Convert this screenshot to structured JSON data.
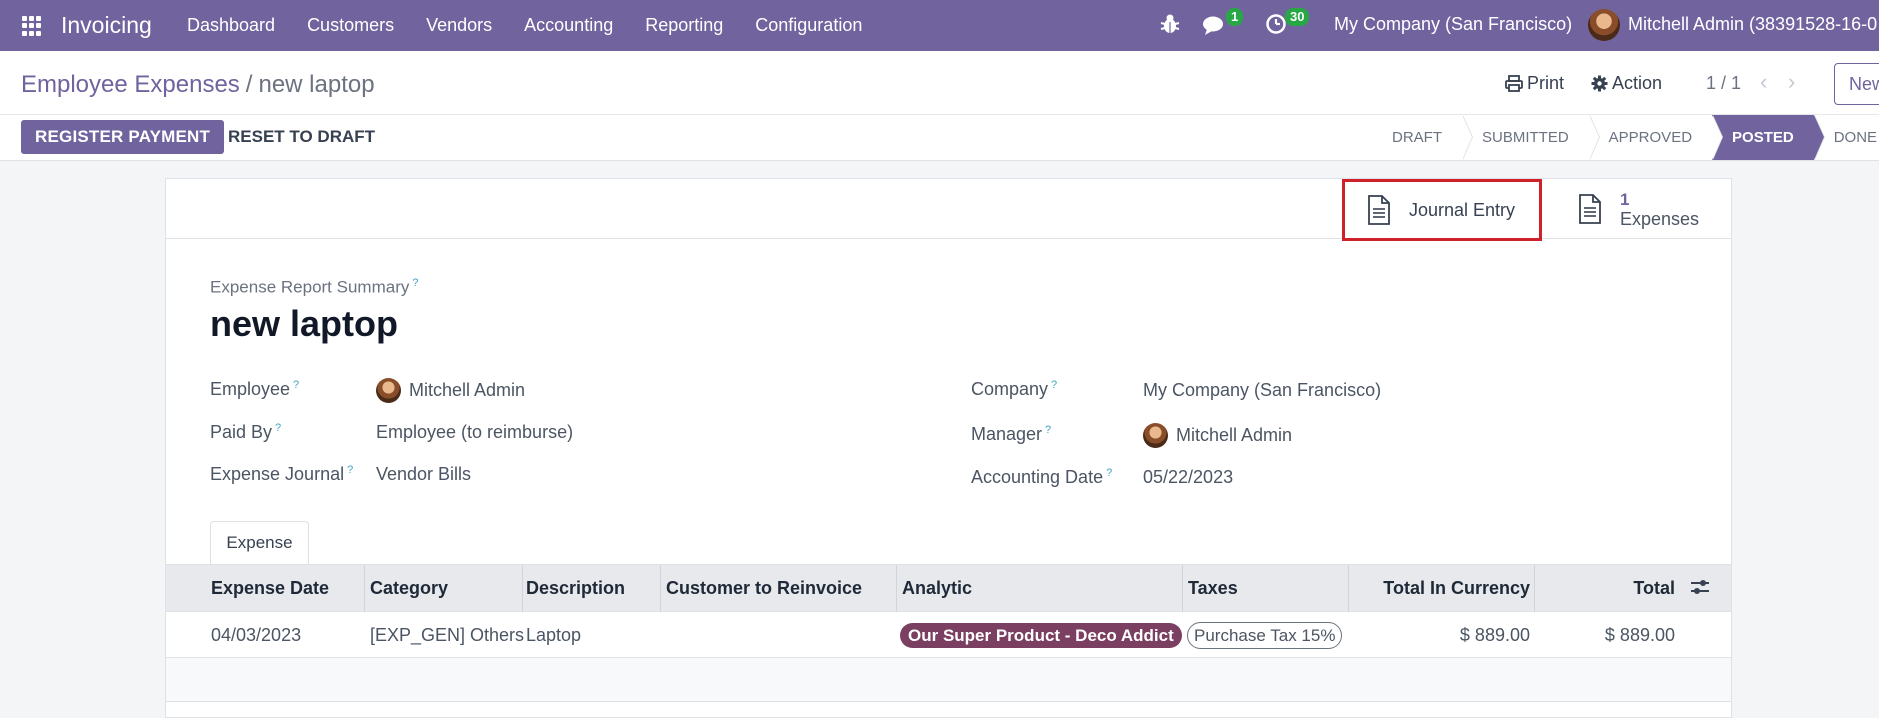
{
  "navbar": {
    "app_name": "Invoicing",
    "menu": [
      "Dashboard",
      "Customers",
      "Vendors",
      "Accounting",
      "Reporting",
      "Configuration"
    ],
    "chat_badge": "1",
    "activity_badge": "30",
    "company": "My Company (San Francisco)",
    "user": "Mitchell Admin (38391528-16-0"
  },
  "control": {
    "breadcrumb_parent": "Employee Expenses",
    "breadcrumb_sep": "/",
    "breadcrumb_current": "new laptop",
    "print_label": "Print",
    "action_label": "Action",
    "pager": "1 / 1",
    "new_label": "New"
  },
  "statusbar": {
    "register_payment": "REGISTER PAYMENT",
    "reset_to_draft": "RESET TO DRAFT",
    "stages": [
      "DRAFT",
      "SUBMITTED",
      "APPROVED",
      "POSTED",
      "DONE"
    ],
    "active_stage": "POSTED"
  },
  "smart_buttons": {
    "journal_entry": "Journal Entry",
    "expenses_count": "1",
    "expenses_label": "Expenses"
  },
  "form": {
    "summary_label": "Expense Report Summary",
    "title": "new laptop",
    "fields_left": [
      {
        "label": "Employee",
        "value": "Mitchell Admin"
      },
      {
        "label": "Paid By",
        "value": "Employee (to reimburse)"
      },
      {
        "label": "Expense Journal",
        "value": "Vendor Bills"
      }
    ],
    "fields_right": [
      {
        "label": "Company",
        "value": "My Company (San Francisco)"
      },
      {
        "label": "Manager",
        "value": "Mitchell Admin"
      },
      {
        "label": "Accounting Date",
        "value": "05/22/2023"
      }
    ],
    "tab": "Expense"
  },
  "table": {
    "headers": [
      "Expense Date",
      "Category",
      "Description",
      "Customer to Reinvoice",
      "Analytic",
      "Taxes",
      "Total In Currency",
      "Total"
    ],
    "rows": [
      {
        "date": "04/03/2023",
        "category": "[EXP_GEN] Others",
        "description": "Laptop",
        "customer": "",
        "analytic": "Our Super Product - Deco Addict",
        "taxes": "Purchase Tax 15%",
        "total_currency": "$ 889.00",
        "total": "$ 889.00"
      }
    ]
  },
  "colors": {
    "brand": "#71639e",
    "highlight": "#d0202a",
    "analytic_tag": "#7b3f61",
    "badge": "#28a745"
  },
  "icons": [
    "apps-icon",
    "bug-icon",
    "chat-icon",
    "clock-icon",
    "print-icon",
    "gear-icon",
    "chevron-left-icon",
    "chevron-right-icon",
    "document-icon",
    "column-settings-icon"
  ]
}
